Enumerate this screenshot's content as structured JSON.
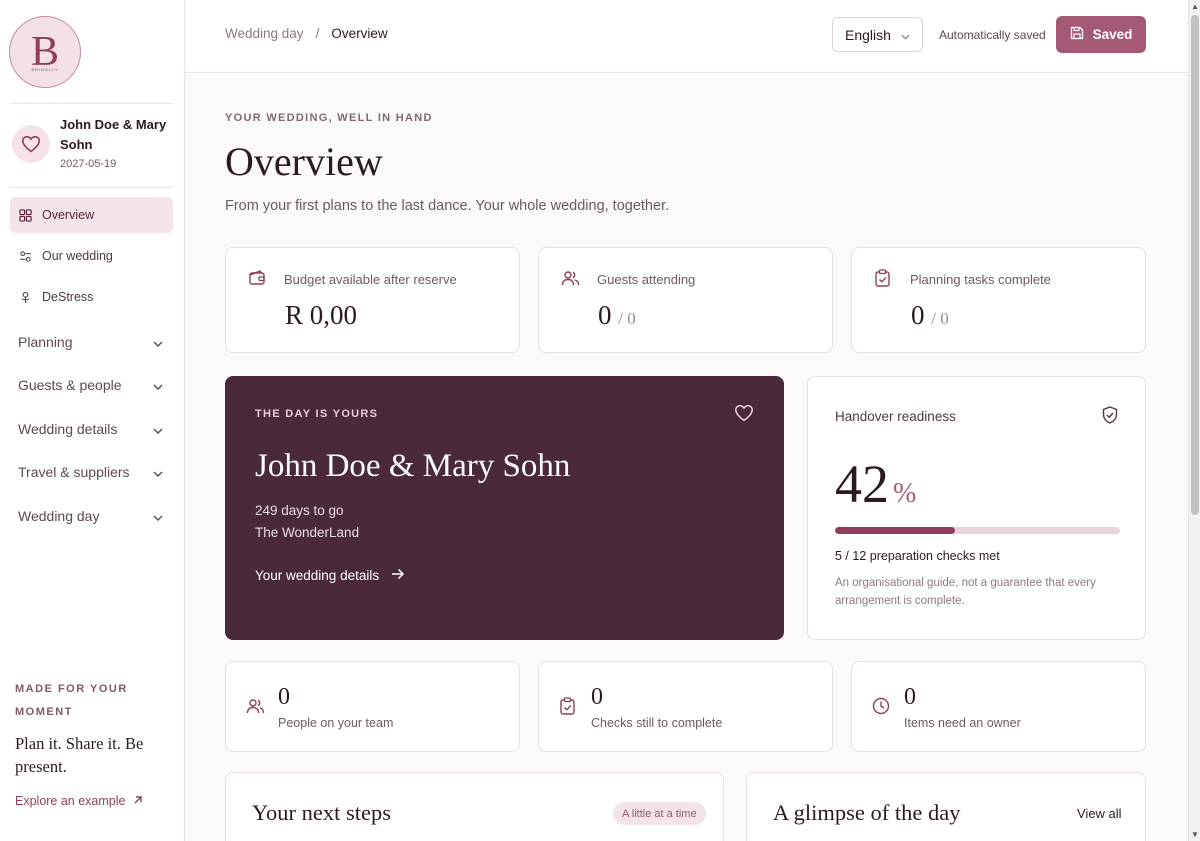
{
  "brand": {
    "logo_letter": "B",
    "logo_sub": "BRIDALLY"
  },
  "couple": {
    "names": "John Doe & Mary Sohn",
    "date": "2027-05-19"
  },
  "nav": {
    "overview": "Overview",
    "our_wedding": "Our wedding",
    "destress": "DeStress",
    "groups": [
      "Planning",
      "Guests & people",
      "Wedding details",
      "Travel & suppliers",
      "Wedding day"
    ]
  },
  "sidebar_footer": {
    "eyebrow": "MADE FOR YOUR MOMENT",
    "tagline": "Plan it. Share it. Be present.",
    "link": "Explore an example"
  },
  "header": {
    "breadcrumb_parent": "Wedding day",
    "breadcrumb_sep": "/",
    "breadcrumb_current": "Overview",
    "language": "English",
    "autosave": "Automatically saved",
    "saved_button": "Saved"
  },
  "page": {
    "eyebrow": "YOUR WEDDING, WELL IN HAND",
    "title": "Overview",
    "subtitle": "From your first plans to the last dance. Your whole wedding, together."
  },
  "stats": [
    {
      "label": "Budget available after reserve",
      "value": "R 0,00",
      "denom": "",
      "icon": "wallet-icon"
    },
    {
      "label": "Guests attending",
      "value": "0",
      "denom": "/ 0",
      "icon": "users-icon"
    },
    {
      "label": "Planning tasks complete",
      "value": "0",
      "denom": "/ 0",
      "icon": "clipboard-check-icon"
    }
  ],
  "hero": {
    "eyebrow": "THE DAY IS YOURS",
    "names": "John Doe & Mary Sohn",
    "countdown": "249 days to go",
    "venue": "The WonderLand",
    "link": "Your wedding details"
  },
  "readiness": {
    "label": "Handover readiness",
    "percent": "42",
    "percent_symbol": "%",
    "progress": 0.42,
    "checks": "5 / 12 preparation checks met",
    "note": "An organisational guide, not a guarantee that every arrangement is complete."
  },
  "mini_stats": [
    {
      "value": "0",
      "label": "People on your team",
      "icon": "users-icon"
    },
    {
      "value": "0",
      "label": "Checks still to complete",
      "icon": "clipboard-check-icon"
    },
    {
      "value": "0",
      "label": "Items need an owner",
      "icon": "clock-icon"
    }
  ],
  "next_steps": {
    "title": "Your next steps",
    "pill": "A little at a time"
  },
  "glimpse": {
    "title": "A glimpse of the day",
    "link": "View all"
  },
  "colors": {
    "accent": "#a45a76",
    "hero_bg": "#4a2a3a",
    "progress_fill": "#8e3e5c",
    "progress_track": "#ead3dc"
  }
}
